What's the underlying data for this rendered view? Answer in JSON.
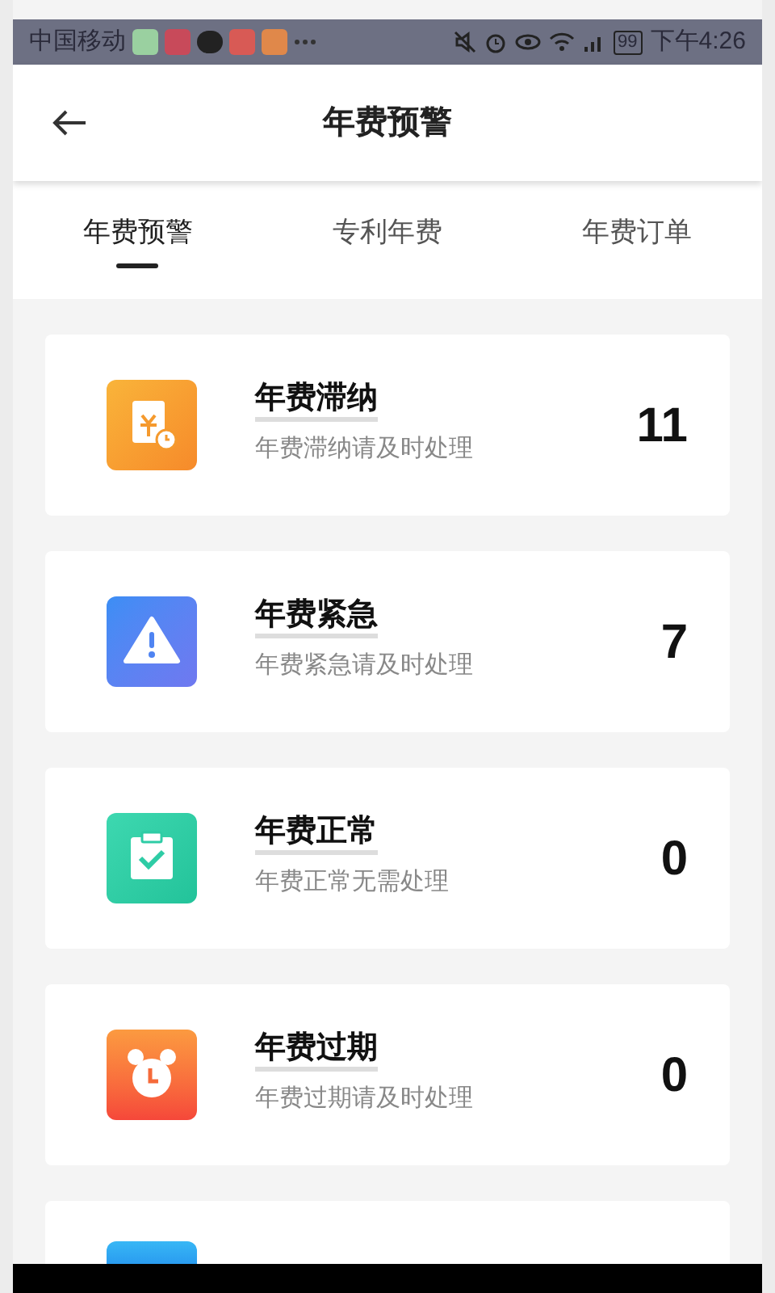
{
  "status_bar": {
    "carrier": "中国移动",
    "battery": "99",
    "time": "下午4:26"
  },
  "header": {
    "title": "年费预警"
  },
  "tabs": [
    {
      "label": "年费预警",
      "selected": true
    },
    {
      "label": "专利年费",
      "selected": false
    },
    {
      "label": "年费订单",
      "selected": false
    }
  ],
  "cards": [
    {
      "kind": "overdue",
      "title": "年费滞纳",
      "subtitle": "年费滞纳请及时处理",
      "count": "11"
    },
    {
      "kind": "urgent",
      "title": "年费紧急",
      "subtitle": "年费紧急请及时处理",
      "count": "7"
    },
    {
      "kind": "normal",
      "title": "年费正常",
      "subtitle": "年费正常无需处理",
      "count": "0"
    },
    {
      "kind": "expired",
      "title": "年费过期",
      "subtitle": "年费过期请及时处理",
      "count": "0"
    },
    {
      "kind": "paid"
    }
  ]
}
